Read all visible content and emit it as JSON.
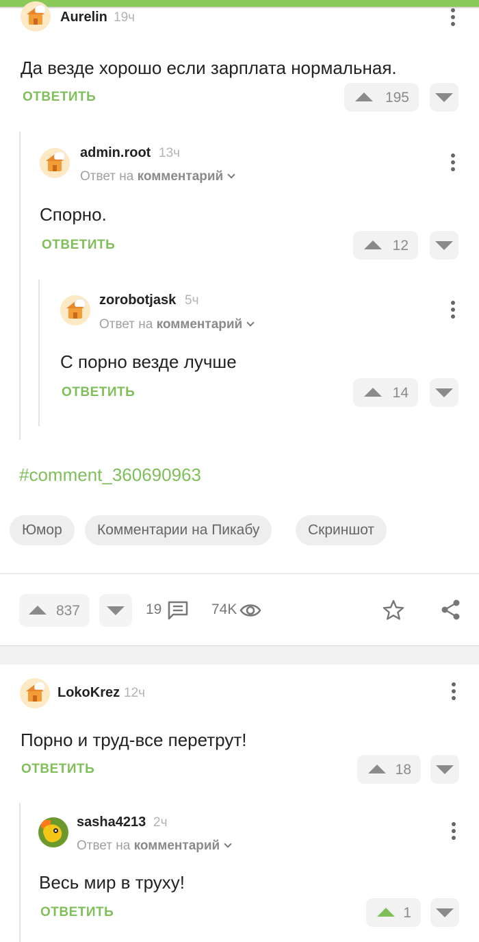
{
  "comments": [
    {
      "author": "Aurelin",
      "time": "19ч",
      "text": "Да везде хорошо если зарплата нормальная.",
      "reply_label": "ОТВЕТИТЬ",
      "votes": "195"
    },
    {
      "author": "admin.root",
      "time": "13ч",
      "reply_to_prefix": "Ответ на",
      "reply_to_target": "комментарий",
      "text": "Спорно.",
      "reply_label": "ОТВЕТИТЬ",
      "votes": "12"
    },
    {
      "author": "zorobotjask",
      "time": "5ч",
      "reply_to_prefix": "Ответ на",
      "reply_to_target": "комментарий",
      "text": "С порно везде лучше",
      "reply_label": "ОТВЕТИТЬ",
      "votes": "14"
    }
  ],
  "post": {
    "hashtag": "#comment_360690963",
    "tags": [
      "Юмор",
      "Комментарии на Пикабу",
      "Скриншот"
    ],
    "rating": "837",
    "comments_count": "19",
    "views": "74K"
  },
  "comments2": [
    {
      "author": "LokoKrez",
      "time": "12ч",
      "text": "Порно и труд-все перетрут!",
      "reply_label": "ОТВЕТИТЬ",
      "votes": "18"
    },
    {
      "author": "sasha4213",
      "time": "2ч",
      "reply_to_prefix": "Ответ на",
      "reply_to_target": "комментарий",
      "text": "Весь мир в труху!",
      "reply_label": "ОТВЕТИТЬ",
      "votes": "1"
    }
  ],
  "colors": {
    "accent": "#7fbf5a",
    "topbar": "#8ac858"
  }
}
